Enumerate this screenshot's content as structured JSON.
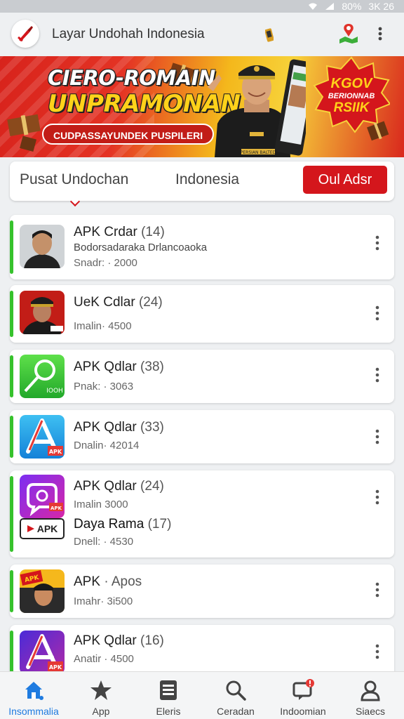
{
  "status_bar": {
    "battery": "80%",
    "time": "3K 26"
  },
  "app_bar": {
    "title": "Layar Undohah Indonesia"
  },
  "banner": {
    "headline_1": "CIERO-ROMAIN",
    "headline_2": "UNPRAMONAN",
    "tagline": "CUDPASSAYUNDEK PUSPILERI",
    "badge_line_1": "KGOV",
    "badge_line_2": "BERIONNAB",
    "badge_line_3": "RSIIK",
    "person_caption": "PERSIAN BALTED",
    "colors": {
      "red": "#d8231c",
      "yellow": "#f7d23a"
    }
  },
  "search": {
    "left_text": "Pusat Undochan",
    "mid_text": "Indonesia",
    "button_label": "Oul Adsr"
  },
  "apps": [
    {
      "title": "APK Crdar",
      "count": "(14)",
      "line": "Bodorsadaraka Drlancoaoka",
      "meta": "Snadr: · 2000",
      "icon": "man-portrait-icon"
    },
    {
      "title": "UeK Cdlar",
      "count": "(24)",
      "line": "",
      "meta": "Imalin· 4500",
      "icon": "officer-portrait-icon"
    },
    {
      "title": "APK Qdlar",
      "count": "(38)",
      "line": "",
      "meta": "Pnak: · 3063",
      "icon": "chat-bubble-icon",
      "icon_badge": "IOOH"
    },
    {
      "title": "APK Qdlar",
      "count": "(33)",
      "line": "",
      "meta": "Dnalin· 42014",
      "icon": "app-a-icon",
      "icon_badge": "APK"
    },
    {
      "title": "APK Qdlar",
      "count": "(24)",
      "line": "",
      "meta": "Imalin 3000",
      "icon": "purple-app-icon",
      "icon_badge": "APK",
      "sub_title": "Daya Rama",
      "sub_count": "(17)",
      "sub_meta": "Dnell: · 4530",
      "sub_badge": "APK"
    },
    {
      "title": "APK",
      "count": "· Apos",
      "line": "",
      "meta": "Imahr· 3i500",
      "icon": "apk-poster-icon",
      "icon_badge": "APK"
    },
    {
      "title": "APK Qdlar",
      "count": "(16)",
      "line": "",
      "meta": "Anatir · 4500",
      "icon": "purple-a-icon",
      "icon_badge": "APK"
    }
  ],
  "bottom_nav": [
    {
      "label": "Insommalia",
      "icon": "home-icon",
      "active": true
    },
    {
      "label": "App",
      "icon": "star-icon",
      "active": false
    },
    {
      "label": "Eleris",
      "icon": "list-doc-icon",
      "active": false
    },
    {
      "label": "Ceradan",
      "icon": "search-icon",
      "active": false
    },
    {
      "label": "Indoomian",
      "icon": "notification-icon",
      "active": false
    },
    {
      "label": "Siaecs",
      "icon": "profile-icon",
      "active": false
    }
  ]
}
